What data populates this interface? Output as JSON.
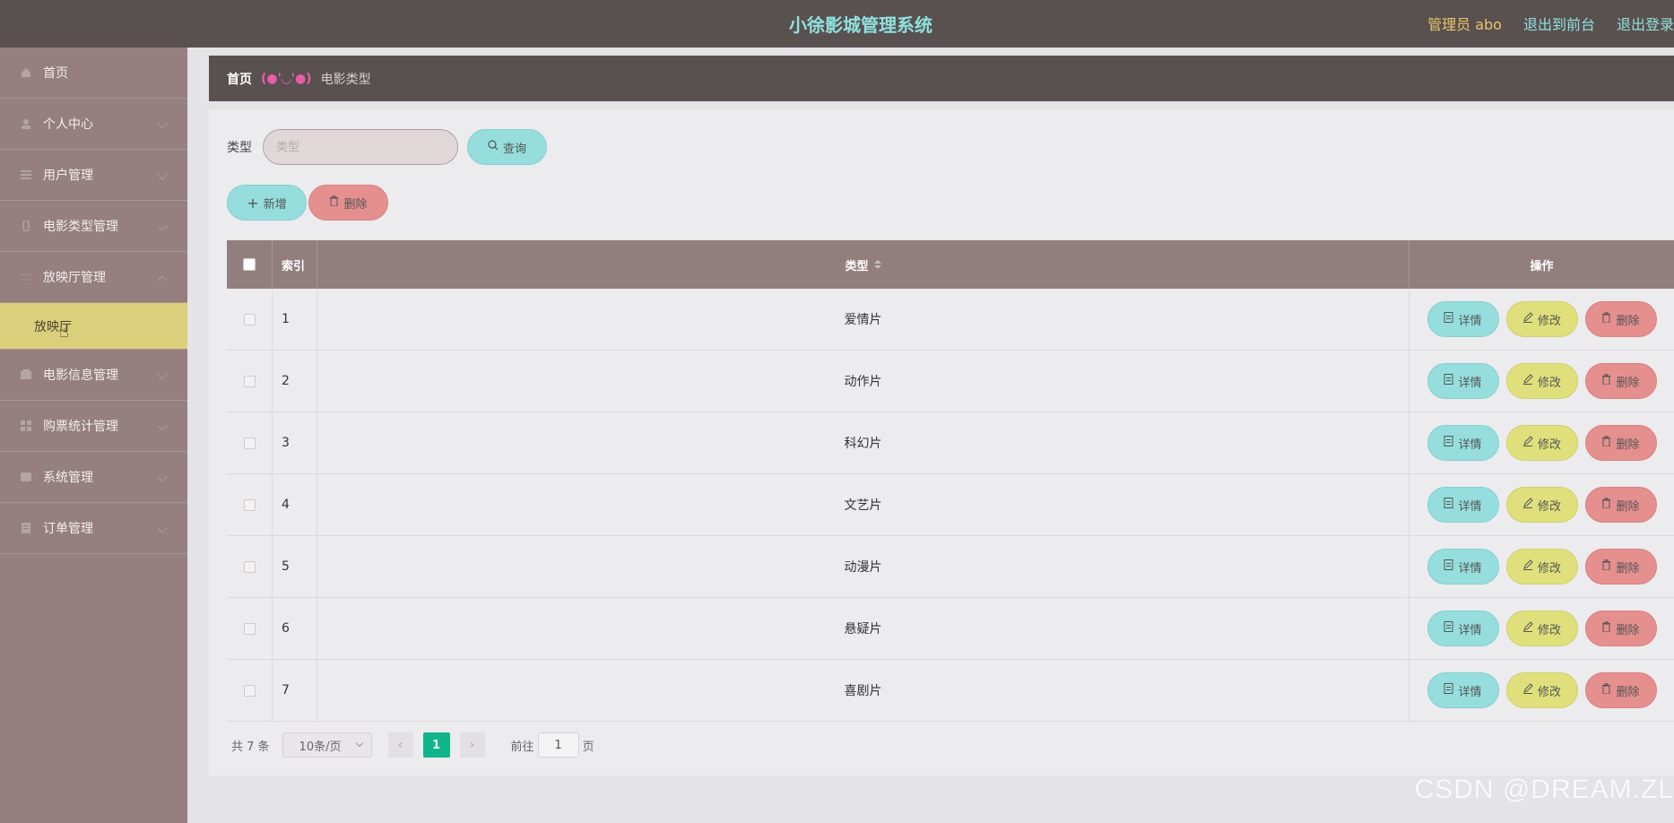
{
  "header": {
    "title": "小徐影城管理系统",
    "admin": "管理员 abo",
    "to_front": "退出到前台",
    "logout": "退出登录"
  },
  "sidebar": {
    "items": [
      {
        "label": "首页",
        "icon": "home-icon"
      },
      {
        "label": "个人中心",
        "icon": "user-icon"
      },
      {
        "label": "用户管理",
        "icon": "list-icon"
      },
      {
        "label": "电影类型管理",
        "icon": "film-icon"
      },
      {
        "label": "放映厅管理",
        "icon": "hall-icon"
      },
      {
        "label": "电影信息管理",
        "icon": "info-icon"
      },
      {
        "label": "购票统计管理",
        "icon": "grid-icon"
      },
      {
        "label": "系统管理",
        "icon": "system-icon"
      },
      {
        "label": "订单管理",
        "icon": "order-icon"
      }
    ],
    "active_sub": "放映厅"
  },
  "breadcrumb": {
    "home": "首页",
    "separator": "(●'◡'●)",
    "current": "电影类型"
  },
  "search": {
    "label": "类型",
    "placeholder": "类型",
    "button": "查询"
  },
  "actions": {
    "add": "新增",
    "delete": "删除"
  },
  "table": {
    "columns": {
      "index": "索引",
      "type": "类型",
      "ops": "操作"
    },
    "rows": [
      {
        "index": "1",
        "type": "爱情片"
      },
      {
        "index": "2",
        "type": "动作片"
      },
      {
        "index": "3",
        "type": "科幻片"
      },
      {
        "index": "4",
        "type": "文艺片"
      },
      {
        "index": "5",
        "type": "动漫片"
      },
      {
        "index": "6",
        "type": "悬疑片"
      },
      {
        "index": "7",
        "type": "喜剧片"
      }
    ],
    "row_actions": {
      "detail": "详情",
      "edit": "修改",
      "delete": "删除"
    }
  },
  "pagination": {
    "total": "共 7 条",
    "page_size": "10条/页",
    "prev": "‹",
    "current": "1",
    "next": "›",
    "goto_label": "前往",
    "goto_value": "1",
    "goto_suffix": "页"
  },
  "watermark": "CSDN @DREAM.ZL",
  "colors": {
    "header_bg": "#595050",
    "title": "#8fe1dd",
    "admin": "#e8c667",
    "sidebar_bg": "#957f7f",
    "active_sub_bg": "#dccf7c",
    "cyan_button": "#95dedd",
    "yellow_button": "#dfe07c",
    "red_button": "#e58f8f",
    "pager_active": "#11b58b"
  }
}
